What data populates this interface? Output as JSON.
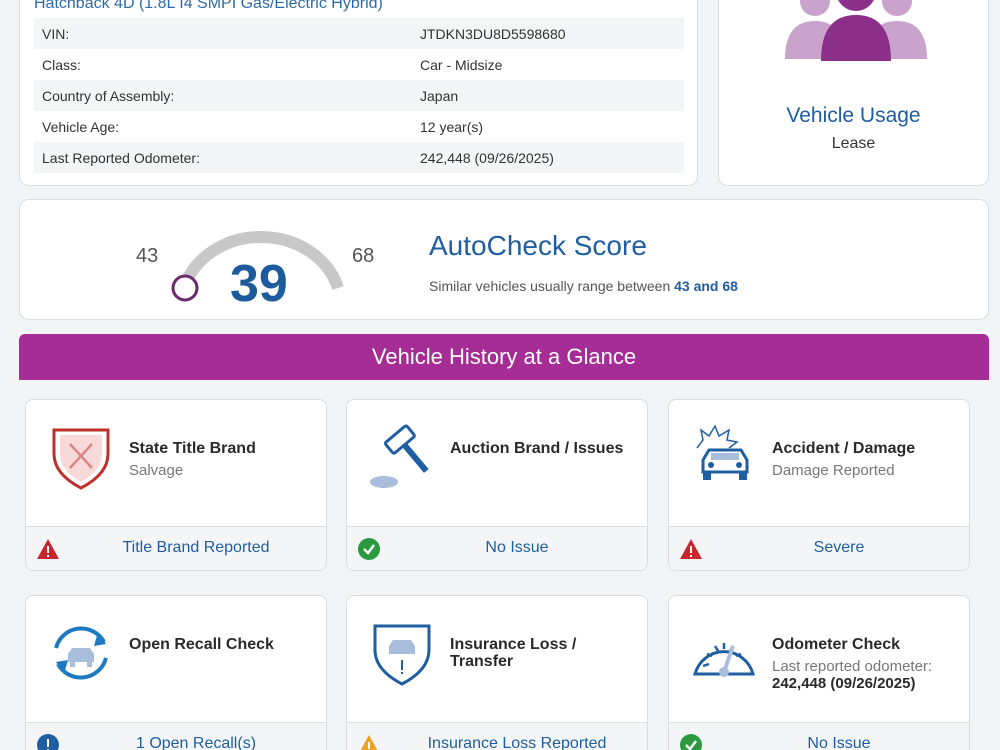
{
  "vehicle": {
    "subtitle": "Hatchback 4D (1.8L I4 SMPI Gas/Electric Hybrid)",
    "specs": [
      {
        "label": "VIN:",
        "value": "JTDKN3DU8D5598680"
      },
      {
        "label": "Class:",
        "value": "Car - Midsize"
      },
      {
        "label": "Country of Assembly:",
        "value": "Japan"
      },
      {
        "label": "Vehicle Age:",
        "value": "12 year(s)"
      },
      {
        "label": "Last Reported Odometer:",
        "value": "242,448 (09/26/2025)"
      }
    ]
  },
  "usage": {
    "title": "Vehicle Usage",
    "value": "Lease",
    "icon": "people-group-icon",
    "color": "#8b2f8a"
  },
  "score": {
    "low": "43",
    "high": "68",
    "score": "39",
    "title": "AutoCheck Score",
    "range_text": "Similar vehicles usually range between",
    "range_value": "43 and 68"
  },
  "history": {
    "banner": "Vehicle History at a Glance",
    "cards": [
      {
        "title": "State Title Brand",
        "sub": "Salvage",
        "status": "Title Brand Reported",
        "status_icon": "warning-red-icon",
        "icon": "shield-x-icon"
      },
      {
        "title": "Auction Brand / Issues",
        "sub": "",
        "status": "No Issue",
        "status_icon": "check-green-icon",
        "icon": "gavel-icon"
      },
      {
        "title": "Accident / Damage",
        "sub": "Damage Reported",
        "status": "Severe",
        "status_icon": "warning-red-icon",
        "icon": "car-crash-icon"
      },
      {
        "title": "Open Recall Check",
        "sub": "",
        "status": "1 Open Recall(s)",
        "status_icon": "info-blue-icon",
        "icon": "recall-car-icon"
      },
      {
        "title": "Insurance Loss / Transfer",
        "sub": "",
        "status": "Insurance Loss Reported",
        "status_icon": "warning-orange-icon",
        "icon": "shield-car-icon"
      },
      {
        "title": "Odometer Check",
        "sub": "Last reported odometer:",
        "sub2": "242,448 (09/26/2025)",
        "status": "No Issue",
        "status_icon": "check-green-icon",
        "icon": "odometer-icon"
      }
    ]
  }
}
